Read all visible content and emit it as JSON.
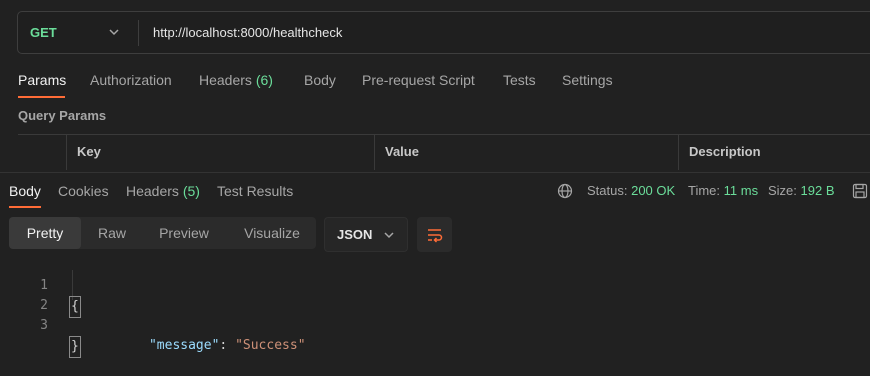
{
  "request": {
    "method": "GET",
    "url": "http://localhost:8000/healthcheck"
  },
  "request_tabs": [
    {
      "label": "Params"
    },
    {
      "label": "Authorization"
    },
    {
      "label": "Headers",
      "count": "(6)"
    },
    {
      "label": "Body"
    },
    {
      "label": "Pre-request Script"
    },
    {
      "label": "Tests"
    },
    {
      "label": "Settings"
    }
  ],
  "query_params": {
    "title": "Query Params",
    "columns": [
      "Key",
      "Value",
      "Description"
    ]
  },
  "response_tabs": [
    {
      "label": "Body"
    },
    {
      "label": "Cookies"
    },
    {
      "label": "Headers",
      "count": "(5)"
    },
    {
      "label": "Test Results"
    }
  ],
  "status": {
    "status_label": "Status:",
    "status_value": "200 OK",
    "time_label": "Time:",
    "time_value": "11 ms",
    "size_label": "Size:",
    "size_value": "192 B"
  },
  "view_modes": [
    "Pretty",
    "Raw",
    "Preview",
    "Visualize"
  ],
  "format": "JSON",
  "colors": {
    "accent": "#ff6c37",
    "method": "#6bdd9a",
    "json_key": "#9cdcfe",
    "json_string": "#ce9178"
  },
  "code": {
    "line_numbers": [
      "1",
      "2",
      "3"
    ],
    "open_brace": "{",
    "key": "\"message\"",
    "colon": ": ",
    "value": "\"Success\"",
    "close_brace": "}"
  }
}
